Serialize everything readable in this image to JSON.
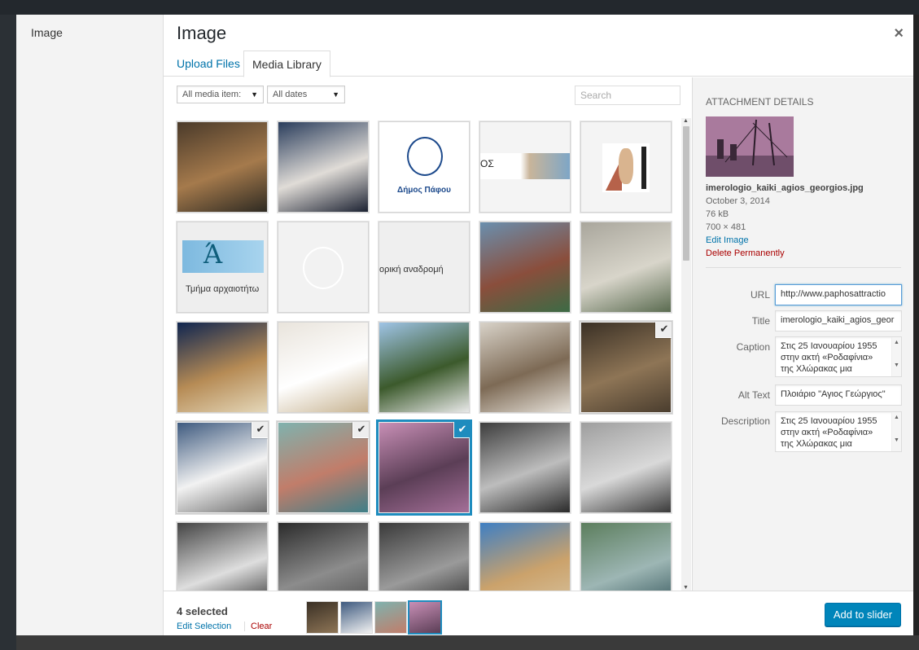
{
  "menu": {
    "items": [
      "Image"
    ]
  },
  "frame": {
    "title": "Image",
    "close_label": "×"
  },
  "tabs": [
    {
      "label": "Upload Files"
    },
    {
      "label": "Media Library"
    }
  ],
  "filters": {
    "type_value": "All media item:",
    "date_value": "All dates",
    "search_placeholder": "Search"
  },
  "thumbnails": [
    {
      "label": "",
      "colors": [
        "#4a3a2a",
        "#a57a4c",
        "#2e2a22"
      ],
      "selected": false
    },
    {
      "label": "",
      "colors": [
        "#2a3d5c",
        "#e0dcd7",
        "#1c2232"
      ],
      "selected": false
    },
    {
      "label": "Δήμος Πάφου",
      "colors": [
        "#ffffff",
        "#ffffff",
        "#ffffff"
      ],
      "selected": false,
      "kind": "logo"
    },
    {
      "label": "ΟΣ",
      "colors": [
        "#ffffff",
        "#c9b59a",
        "#7ea6c6"
      ],
      "selected": false,
      "kind": "banner"
    },
    {
      "label": "",
      "colors": [
        "#ffffff",
        "#b6624a",
        "#222222"
      ],
      "selected": false,
      "kind": "statue"
    },
    {
      "label": "Τμήμα αρχαιοτήτω",
      "colors": [
        "#7db9df",
        "#e6e6e6",
        "#3d7e9a"
      ],
      "selected": false,
      "kind": "dept"
    },
    {
      "label": "",
      "colors": [
        "#f0f0f0",
        "#ffffff",
        "#dddddd"
      ],
      "selected": false,
      "kind": "faded"
    },
    {
      "label": "ορική αναδρομή",
      "colors": [
        "#efefef",
        "#efefef",
        "#efefef"
      ],
      "selected": false,
      "kind": "text"
    },
    {
      "label": "",
      "colors": [
        "#6a8fae",
        "#8a4e3c",
        "#3c6b45"
      ],
      "selected": false
    },
    {
      "label": "",
      "colors": [
        "#a9a69c",
        "#d8d5ca",
        "#5a6b50"
      ],
      "selected": false
    },
    {
      "label": "",
      "colors": [
        "#0f2550",
        "#b68b55",
        "#e4d7b9"
      ],
      "selected": false
    },
    {
      "label": "",
      "colors": [
        "#e9e4dc",
        "#ffffff",
        "#c7b391"
      ],
      "selected": false
    },
    {
      "label": "",
      "colors": [
        "#9fc4e6",
        "#3c5a2c",
        "#e9e9e9"
      ],
      "selected": false
    },
    {
      "label": "",
      "colors": [
        "#d8d2c8",
        "#7d6a55",
        "#e6e1d9"
      ],
      "selected": false
    },
    {
      "label": "",
      "colors": [
        "#3a3025",
        "#8e7556",
        "#4a3d2e"
      ],
      "selected": true
    },
    {
      "label": "",
      "colors": [
        "#3e5a7f",
        "#f2f2f2",
        "#6c6c6c"
      ],
      "selected": true
    },
    {
      "label": "",
      "colors": [
        "#7fb2ae",
        "#c17d6a",
        "#3f7f88"
      ],
      "selected": true
    },
    {
      "label": "",
      "colors": [
        "#c88fb6",
        "#5b3e56",
        "#a46f98"
      ],
      "selected": true,
      "active": true
    },
    {
      "label": "",
      "colors": [
        "#3d3d3d",
        "#bdbdbd",
        "#2a2a2a"
      ],
      "selected": false
    },
    {
      "label": "",
      "colors": [
        "#9e9e9e",
        "#d9d9d9",
        "#3a3a3a"
      ],
      "selected": false
    },
    {
      "label": "",
      "colors": [
        "#444444",
        "#dedede",
        "#222222"
      ],
      "selected": false
    },
    {
      "label": "",
      "colors": [
        "#2b2b2b",
        "#8c8c8c",
        "#4a4a4a"
      ],
      "selected": false
    },
    {
      "label": "",
      "colors": [
        "#3a3a3a",
        "#9a9a9a",
        "#1f1f1f"
      ],
      "selected": false
    },
    {
      "label": "",
      "colors": [
        "#3f7fc3",
        "#cba26b",
        "#d7c4a1"
      ],
      "selected": false
    },
    {
      "label": "",
      "colors": [
        "#5c7e5d",
        "#9db6b4",
        "#2e5056"
      ],
      "selected": false
    }
  ],
  "details": {
    "heading": "ATTACHMENT DETAILS",
    "filename": "imerologio_kaiki_agios_georgios.jpg",
    "date": "October 3, 2014",
    "size": "76 kB",
    "dimensions": "700 × 481",
    "edit_label": "Edit Image",
    "delete_label": "Delete Permanently",
    "fields": {
      "url_label": "URL",
      "url_value": "http://www.paphosattractio",
      "title_label": "Title",
      "title_value": "imerologio_kaiki_agios_geor",
      "caption_label": "Caption",
      "caption_value": "Στις 25 Ιανουαρίου 1955 στην ακτή «Ροδαφίνια» της Χλώρακας μια",
      "alt_label": "Alt Text",
      "alt_value": "Πλοιάριο \"Αγιος Γεώργιος\"",
      "desc_label": "Description",
      "desc_value": "Στις 25 Ιανουαρίου 1955 στην ακτή «Ροδαφίνια» της Χλώρακας μια"
    }
  },
  "selection": {
    "count": "4 selected",
    "edit_label": "Edit Selection",
    "clear_label": "Clear",
    "minis": [
      {
        "colors": [
          "#3a3025",
          "#8e7556"
        ]
      },
      {
        "colors": [
          "#3e5a7f",
          "#f2f2f2"
        ]
      },
      {
        "colors": [
          "#7fb2ae",
          "#c17d6a"
        ]
      },
      {
        "colors": [
          "#c88fb6",
          "#5b3e56"
        ],
        "active": true
      }
    ]
  },
  "primary_button": "Add to slider"
}
